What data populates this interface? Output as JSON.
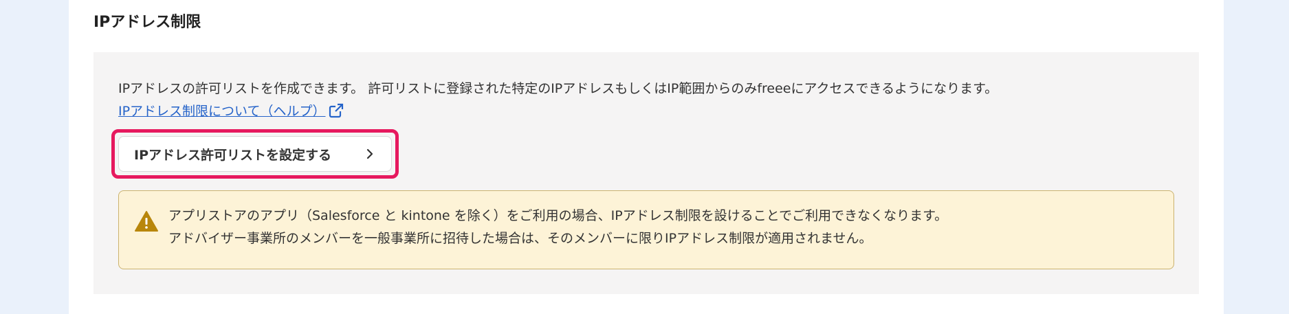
{
  "section": {
    "title": "IPアドレス制限"
  },
  "description": {
    "line1": "IPアドレスの許可リストを作成できます。 許可リストに登録された特定のIPアドレスもしくはIP範囲からのみfreeeにアクセスできるようになります。",
    "help_link": "IPアドレス制限について（ヘルプ）"
  },
  "button": {
    "label": "IPアドレス許可リストを設定する"
  },
  "warning": {
    "line1": "アプリストアのアプリ（Salesforce と kintone を除く）をご利用の場合、IPアドレス制限を設けることでご利用できなくなります。",
    "line2": "アドバイザー事業所のメンバーを一般事業所に招待した場合は、そのメンバーに限りIPアドレス制限が適用されません。"
  },
  "icons": {
    "external": "external-link-icon",
    "chevron": "chevron-right-icon",
    "warning": "warning-triangle-icon"
  },
  "colors": {
    "background": "#eaf1fb",
    "panel": "#ffffff",
    "content_box": "#f5f4f4",
    "link": "#2563c9",
    "focus_ring": "#e6195e",
    "warning_bg": "#fdf3d7",
    "warning_border": "#cbb36f",
    "warning_icon": "#b8860b"
  }
}
